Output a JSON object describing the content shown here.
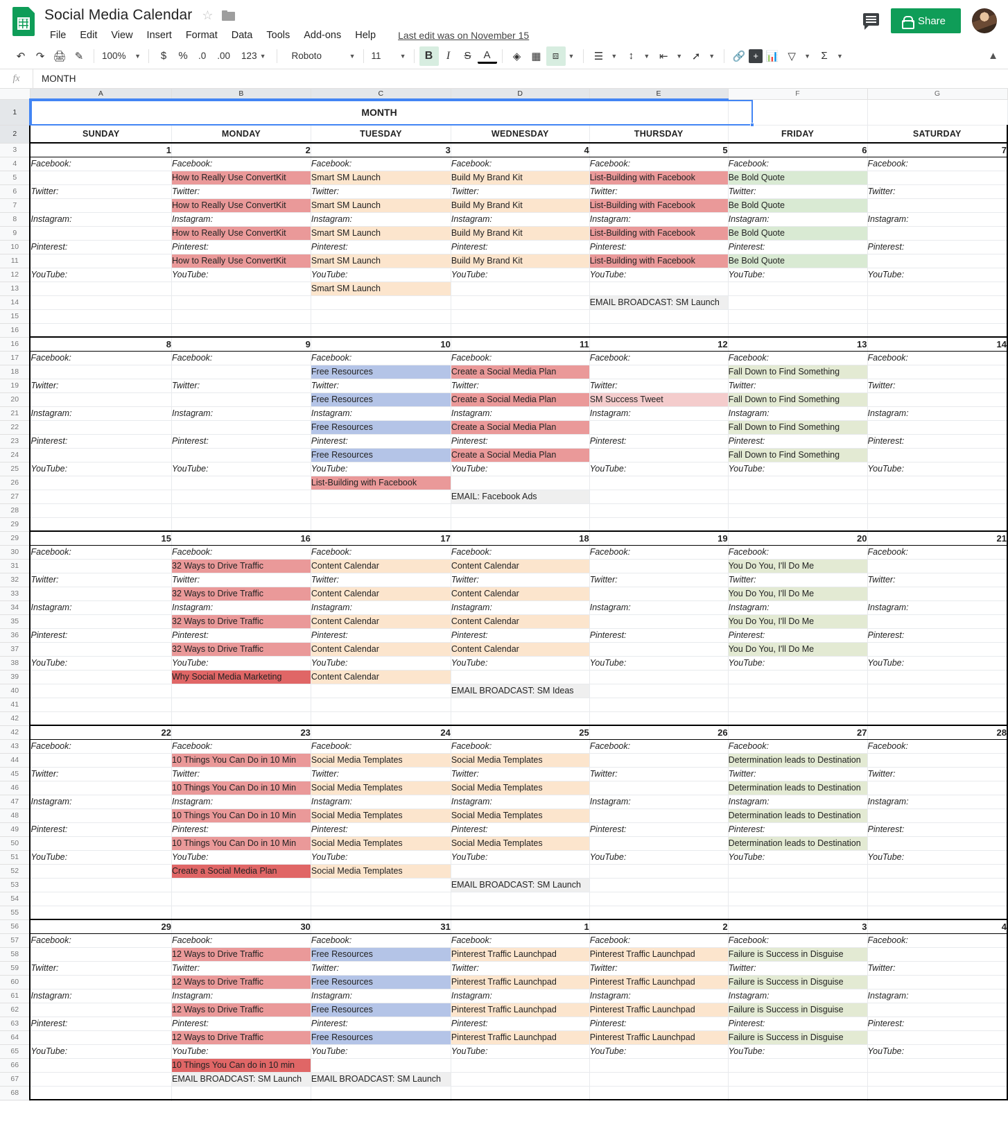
{
  "app": {
    "doc_title": "Social Media Calendar",
    "last_edit": "Last edit was on November 15",
    "menus": [
      "File",
      "Edit",
      "View",
      "Insert",
      "Format",
      "Data",
      "Tools",
      "Add-ons",
      "Help"
    ],
    "share_label": "Share"
  },
  "toolbar": {
    "zoom": "100%",
    "currency": "$",
    "percent": "%",
    "dec_less": ".0",
    "dec_more": ".00",
    "formats": "123",
    "font": "Roboto",
    "font_size": "11",
    "bold": "B",
    "italic": "I",
    "strike": "S",
    "text_color": "A"
  },
  "formula_bar": {
    "fx": "fx",
    "value": "MONTH"
  },
  "grid": {
    "columns": [
      "A",
      "B",
      "C",
      "D",
      "E",
      "F",
      "G"
    ],
    "selected_columns": [
      "A",
      "B",
      "C",
      "D",
      "E"
    ],
    "month_label": "MONTH",
    "day_names": [
      "SUNDAY",
      "MONDAY",
      "TUESDAY",
      "WEDNESDAY",
      "THURSDAY",
      "FRIDAY",
      "SATURDAY"
    ],
    "platforms": [
      "Facebook:",
      "Twitter:",
      "Instagram:",
      "Pinterest:",
      "YouTube:"
    ],
    "colors": {
      "red": "#ea9999",
      "dark_red": "#e06666",
      "pink": "#f4cccc",
      "yellow": "#fce5cd",
      "green": "#d9ead3",
      "olive": "#e3ead3",
      "blue": "#b4c4e7",
      "gray": "#efefef",
      "accent": "#4285f4",
      "brand_green": "#0f9d58"
    },
    "weeks": [
      {
        "row_start": 3,
        "dates": [
          "1",
          "2",
          "3",
          "4",
          "5",
          "6",
          "7"
        ],
        "days": [
          {
            "posts": [
              "",
              "",
              "",
              "",
              ""
            ],
            "extra": "",
            "extra_color": ""
          },
          {
            "posts": [
              "How to Really Use ConvertKit",
              "How to Really Use ConvertKit",
              "How to Really Use ConvertKit",
              "How to Really Use ConvertKit",
              ""
            ],
            "colors": [
              "red",
              "red",
              "red",
              "red",
              ""
            ],
            "extra": "",
            "extra_color": ""
          },
          {
            "posts": [
              "Smart SM Launch",
              "Smart SM Launch",
              "Smart SM Launch",
              "Smart SM Launch",
              "Smart SM Launch"
            ],
            "colors": [
              "yellow",
              "yellow",
              "yellow",
              "yellow",
              "yellow"
            ],
            "extra": "",
            "extra_color": ""
          },
          {
            "posts": [
              "Build My Brand Kit",
              "Build My Brand Kit",
              "Build My Brand Kit",
              "Build My Brand Kit",
              ""
            ],
            "colors": [
              "yellow",
              "yellow",
              "yellow",
              "yellow",
              ""
            ],
            "extra": "",
            "extra_color": ""
          },
          {
            "posts": [
              "List-Building with Facebook",
              "List-Building with Facebook",
              "List-Building with Facebook",
              "List-Building with Facebook",
              ""
            ],
            "colors": [
              "red",
              "red",
              "red",
              "red",
              ""
            ],
            "extra": "EMAIL BROADCAST: SM Launch",
            "extra_color": "gray"
          },
          {
            "posts": [
              "Be Bold Quote",
              "Be Bold Quote",
              "Be Bold Quote",
              "Be Bold Quote",
              ""
            ],
            "colors": [
              "green",
              "green",
              "green",
              "green",
              ""
            ],
            "extra": "",
            "extra_color": ""
          },
          {
            "posts": [
              "",
              "",
              "",
              "",
              ""
            ],
            "extra": "",
            "extra_color": ""
          }
        ]
      },
      {
        "row_start": 16,
        "dates": [
          "8",
          "9",
          "10",
          "11",
          "12",
          "13",
          "14"
        ],
        "days": [
          {
            "posts": [
              "",
              "",
              "",
              "",
              ""
            ],
            "extra": "",
            "extra_color": ""
          },
          {
            "posts": [
              "",
              "",
              "",
              "",
              ""
            ],
            "extra": "",
            "extra_color": ""
          },
          {
            "posts": [
              "Free Resources",
              "Free Resources",
              "Free Resources",
              "Free Resources",
              "List-Building with Facebook"
            ],
            "colors": [
              "blue",
              "blue",
              "blue",
              "blue",
              "red"
            ],
            "extra": "",
            "extra_color": ""
          },
          {
            "posts": [
              "Create a Social Media Plan",
              "Create a Social Media Plan",
              "Create a Social Media Plan",
              "Create a Social Media Plan",
              ""
            ],
            "colors": [
              "red",
              "red",
              "red",
              "red",
              ""
            ],
            "extra": "EMAIL: Facebook Ads",
            "extra_color": "gray"
          },
          {
            "posts": [
              "",
              "SM Success Tweet",
              "",
              "",
              ""
            ],
            "colors": [
              "",
              "pink",
              "",
              "",
              ""
            ],
            "extra": "",
            "extra_color": ""
          },
          {
            "posts": [
              "Fall Down to Find Something",
              "Fall Down to Find Something",
              "Fall Down to Find Something",
              "Fall Down to Find Something",
              ""
            ],
            "colors": [
              "olive",
              "olive",
              "olive",
              "olive",
              ""
            ],
            "extra": "",
            "extra_color": ""
          },
          {
            "posts": [
              "",
              "",
              "",
              "",
              ""
            ],
            "extra": "",
            "extra_color": ""
          }
        ]
      },
      {
        "row_start": 29,
        "dates": [
          "15",
          "16",
          "17",
          "18",
          "19",
          "20",
          "21"
        ],
        "days": [
          {
            "posts": [
              "",
              "",
              "",
              "",
              ""
            ],
            "extra": "",
            "extra_color": ""
          },
          {
            "posts": [
              "32 Ways to Drive Traffic",
              "32 Ways to Drive Traffic",
              "32 Ways to Drive Traffic",
              "32 Ways to Drive Traffic",
              "Why Social Media Marketing"
            ],
            "colors": [
              "red",
              "red",
              "red",
              "red",
              "dark_red"
            ],
            "extra": "",
            "extra_color": ""
          },
          {
            "posts": [
              "Content Calendar",
              "Content Calendar",
              "Content Calendar",
              "Content Calendar",
              "Content Calendar"
            ],
            "colors": [
              "yellow",
              "yellow",
              "yellow",
              "yellow",
              "yellow"
            ],
            "extra": "",
            "extra_color": ""
          },
          {
            "posts": [
              "Content Calendar",
              "Content Calendar",
              "Content Calendar",
              "Content Calendar",
              ""
            ],
            "colors": [
              "yellow",
              "yellow",
              "yellow",
              "yellow",
              ""
            ],
            "extra": "EMAIL BROADCAST: SM Ideas",
            "extra_color": "gray"
          },
          {
            "posts": [
              "",
              "",
              "",
              "",
              ""
            ],
            "extra": "",
            "extra_color": ""
          },
          {
            "posts": [
              "You Do You, I'll Do Me",
              "You Do You, I'll Do Me",
              "You Do You, I'll Do Me",
              "You Do You, I'll Do Me",
              ""
            ],
            "colors": [
              "olive",
              "olive",
              "olive",
              "olive",
              ""
            ],
            "extra": "",
            "extra_color": ""
          },
          {
            "posts": [
              "",
              "",
              "",
              "",
              ""
            ],
            "extra": "",
            "extra_color": ""
          }
        ]
      },
      {
        "row_start": 42,
        "dates": [
          "22",
          "23",
          "24",
          "25",
          "26",
          "27",
          "28"
        ],
        "days": [
          {
            "posts": [
              "",
              "",
              "",
              "",
              ""
            ],
            "extra": "",
            "extra_color": ""
          },
          {
            "posts": [
              "10 Things You Can Do in 10 Min",
              "10 Things You Can Do in 10 Min",
              "10 Things You Can Do in 10 Min",
              "10 Things You Can Do in 10 Min",
              "Create a Social Media Plan"
            ],
            "colors": [
              "red",
              "red",
              "red",
              "red",
              "dark_red"
            ],
            "extra": "",
            "extra_color": ""
          },
          {
            "posts": [
              "Social Media Templates",
              "Social Media Templates",
              "Social Media Templates",
              "Social Media Templates",
              "Social Media Templates"
            ],
            "colors": [
              "yellow",
              "yellow",
              "yellow",
              "yellow",
              "yellow"
            ],
            "extra": "",
            "extra_color": ""
          },
          {
            "posts": [
              "Social Media Templates",
              "Social Media Templates",
              "Social Media Templates",
              "Social Media Templates",
              ""
            ],
            "colors": [
              "yellow",
              "yellow",
              "yellow",
              "yellow",
              ""
            ],
            "extra": "EMAIL BROADCAST: SM Launch",
            "extra_color": "gray"
          },
          {
            "posts": [
              "",
              "",
              "",
              "",
              ""
            ],
            "extra": "",
            "extra_color": ""
          },
          {
            "posts": [
              "Determination leads to Destination",
              "Determination leads to Destination",
              "Determination leads to Destination",
              "Determination leads to Destination",
              ""
            ],
            "colors": [
              "olive",
              "olive",
              "olive",
              "olive",
              ""
            ],
            "extra": "",
            "extra_color": ""
          },
          {
            "posts": [
              "",
              "",
              "",
              "",
              ""
            ],
            "extra": "",
            "extra_color": ""
          }
        ]
      },
      {
        "row_start": 56,
        "dates": [
          "29",
          "30",
          "31",
          "1",
          "2",
          "3",
          "4"
        ],
        "days": [
          {
            "posts": [
              "",
              "",
              "",
              "",
              ""
            ],
            "extra": "",
            "extra_color": ""
          },
          {
            "posts": [
              "12 Ways to Drive Traffic",
              "12 Ways to Drive Traffic",
              "12 Ways to Drive Traffic",
              "12 Ways to Drive Traffic",
              "10 Things You Can do in 10 min"
            ],
            "colors": [
              "red",
              "red",
              "red",
              "red",
              "dark_red"
            ],
            "extra": "EMAIL BROADCAST: SM Launch",
            "extra_color": "gray"
          },
          {
            "posts": [
              "Free Resources",
              "Free Resources",
              "Free Resources",
              "Free Resources",
              ""
            ],
            "colors": [
              "blue",
              "blue",
              "blue",
              "blue",
              ""
            ],
            "extra": "EMAIL BROADCAST: SM Launch",
            "extra_color": "gray"
          },
          {
            "posts": [
              "Pinterest Traffic Launchpad",
              "Pinterest Traffic Launchpad",
              "Pinterest Traffic Launchpad",
              "Pinterest Traffic Launchpad",
              ""
            ],
            "colors": [
              "yellow",
              "yellow",
              "yellow",
              "yellow",
              ""
            ],
            "extra": "",
            "extra_color": ""
          },
          {
            "posts": [
              "Pinterest Traffic Launchpad",
              "Pinterest Traffic Launchpad",
              "Pinterest Traffic Launchpad",
              "Pinterest Traffic Launchpad",
              ""
            ],
            "colors": [
              "yellow",
              "yellow",
              "yellow",
              "yellow",
              ""
            ],
            "extra": "",
            "extra_color": ""
          },
          {
            "posts": [
              "Failure is Success in Disguise",
              "Failure is Success in Disguise",
              "Failure is Success in Disguise",
              "Failure is Success in Disguise",
              ""
            ],
            "colors": [
              "olive",
              "olive",
              "olive",
              "olive",
              ""
            ],
            "extra": "",
            "extra_color": ""
          },
          {
            "posts": [
              "",
              "",
              "",
              "",
              ""
            ],
            "extra": "",
            "extra_color": ""
          }
        ]
      }
    ]
  }
}
